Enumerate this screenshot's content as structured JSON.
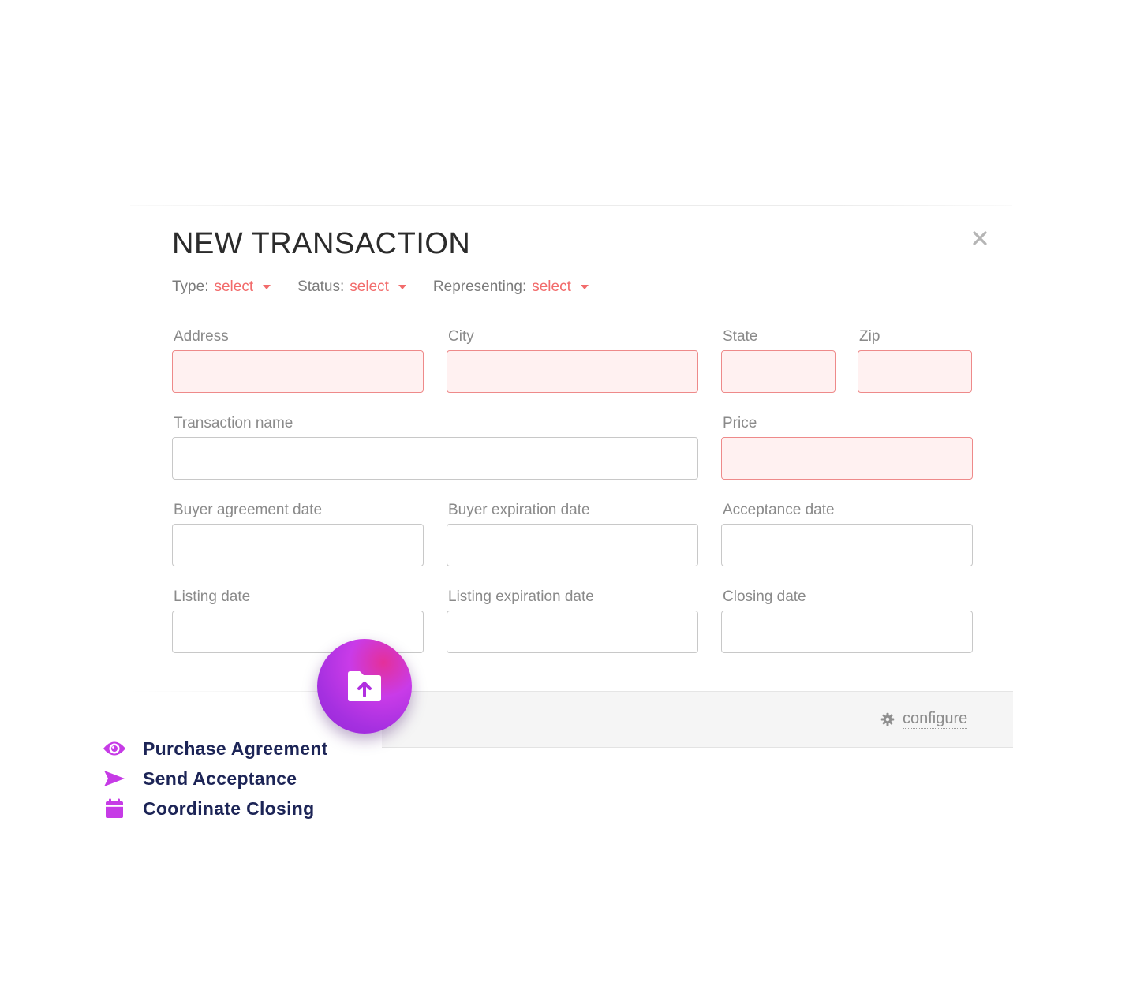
{
  "dialog": {
    "title": "NEW TRANSACTION"
  },
  "filters": [
    {
      "label": "Type:",
      "value": "select"
    },
    {
      "label": "Status:",
      "value": "select"
    },
    {
      "label": "Representing:",
      "value": "select"
    }
  ],
  "fields": {
    "address": {
      "label": "Address",
      "value": "",
      "state": "error"
    },
    "city": {
      "label": "City",
      "value": "",
      "state": "error"
    },
    "state": {
      "label": "State",
      "value": "",
      "state": "error"
    },
    "zip": {
      "label": "Zip",
      "value": "",
      "state": "error"
    },
    "transaction_name": {
      "label": "Transaction name",
      "value": ""
    },
    "price": {
      "label": "Price",
      "value": "",
      "state": "error"
    },
    "buyer_agreement_date": {
      "label": "Buyer agreement date",
      "value": ""
    },
    "buyer_expiration_date": {
      "label": "Buyer expiration date",
      "value": ""
    },
    "acceptance_date": {
      "label": "Acceptance date",
      "value": ""
    },
    "listing_date": {
      "label": "Listing date",
      "value": ""
    },
    "listing_expiration_date": {
      "label": "Listing expiration date",
      "value": ""
    },
    "closing_date": {
      "label": "Closing date",
      "value": ""
    }
  },
  "footer": {
    "configure_label": "configure"
  },
  "actions": [
    {
      "label": "Purchase Agreement",
      "icon": "eye-icon"
    },
    {
      "label": "Send Acceptance",
      "icon": "send-icon"
    },
    {
      "label": "Coordinate Closing",
      "icon": "calendar-icon"
    }
  ],
  "colors": {
    "error_border": "#ee8a8a",
    "error_fill": "#fff1f1",
    "accent_red": "#f26b6b",
    "action_purple": "#c63be6",
    "action_text": "#1c2456"
  }
}
